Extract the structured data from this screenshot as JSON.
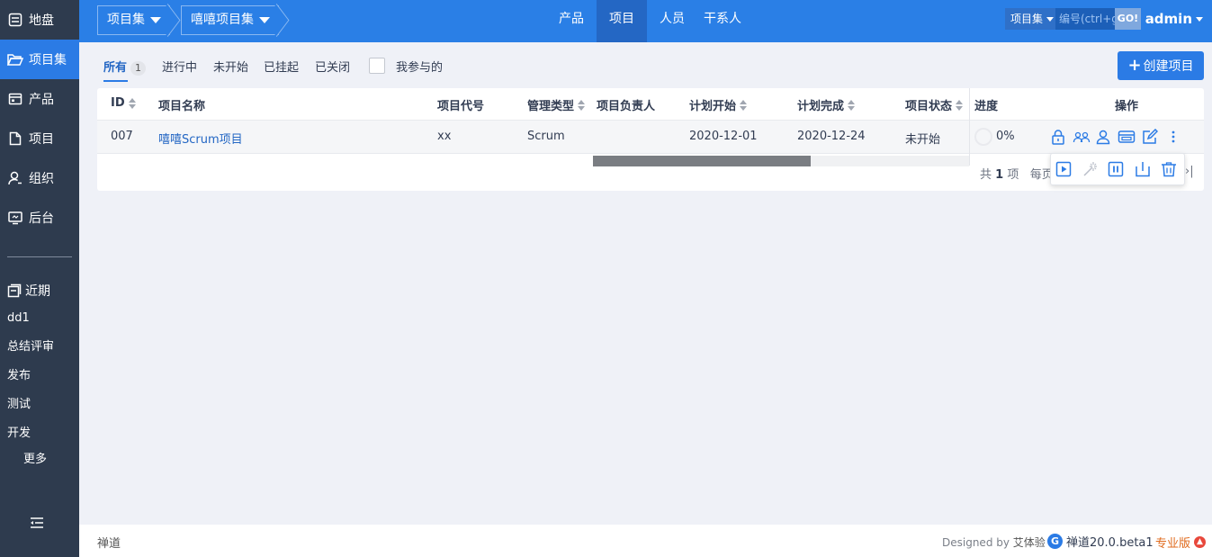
{
  "sidebar": {
    "nav": [
      {
        "label": "地盘",
        "icon": "home-icon"
      },
      {
        "label": "项目集",
        "icon": "folder-open-icon"
      },
      {
        "label": "产品",
        "icon": "product-icon"
      },
      {
        "label": "项目",
        "icon": "file-icon"
      },
      {
        "label": "组织",
        "icon": "user-icon"
      },
      {
        "label": "后台",
        "icon": "monitor-icon"
      }
    ],
    "recent_label": "近期",
    "recent": [
      "dd1",
      "总结评审",
      "发布",
      "测试",
      "开发"
    ],
    "more_label": "更多"
  },
  "topbar": {
    "breadcrumbs": [
      "项目集",
      "嘻嘻项目集"
    ],
    "nav": [
      "产品",
      "项目",
      "人员",
      "干系人"
    ],
    "active_nav": "项目",
    "search": {
      "type": "项目集",
      "placeholder": "编号(ctrl+g)",
      "go": "GO!"
    },
    "user": "admin"
  },
  "filters": {
    "tabs": [
      {
        "label": "所有",
        "count": "1"
      },
      {
        "label": "进行中"
      },
      {
        "label": "未开始"
      },
      {
        "label": "已挂起"
      },
      {
        "label": "已关闭"
      }
    ],
    "mine_label": "我参与的",
    "create_label": "创建项目"
  },
  "table": {
    "columns": {
      "id": "ID",
      "name": "项目名称",
      "code": "项目代号",
      "type": "管理类型",
      "owner": "项目负责人",
      "begin": "计划开始",
      "end": "计划完成",
      "status": "项目状态",
      "progress": "进度",
      "actions": "操作"
    },
    "rows": [
      {
        "id": "007",
        "name": "嘻嘻Scrum项目",
        "code": "xx",
        "type": "Scrum",
        "owner": "",
        "begin": "2020-12-01",
        "end": "2020-12-24",
        "status": "未开始",
        "progress": "0%",
        "progress_value": 0
      }
    ],
    "pager": {
      "prefix": "共",
      "total": "1",
      "suffix": "项",
      "per_page_label": "每页",
      "last": "›|"
    }
  },
  "actions": {
    "row": [
      "lock-icon",
      "team-icon",
      "member-icon",
      "whitelist-icon",
      "edit-icon",
      "more-icon"
    ],
    "popup": [
      "start-icon",
      "magic-icon",
      "suspend-icon",
      "close-project-icon",
      "delete-icon"
    ]
  },
  "footer": {
    "brand": "禅道",
    "designed_by": "Designed by",
    "designer": "艾体验",
    "version": "禅道20.0.beta1",
    "edition": "专业版"
  },
  "colors": {
    "accent": "#2b7be5",
    "sidebar": "#2e3b4e",
    "topbar": "#2a7fe6",
    "edition": "#e06a1c"
  }
}
